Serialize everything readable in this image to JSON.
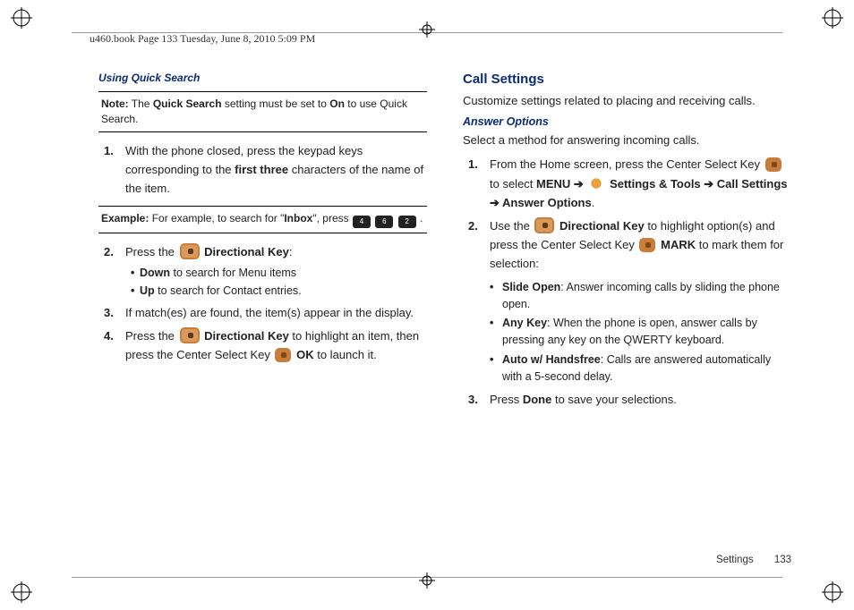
{
  "header": "u460.book  Page 133  Tuesday, June 8, 2010  5:09 PM",
  "left": {
    "heading": "Using Quick Search",
    "note_label": "Note:",
    "note_text_1": " The ",
    "note_bold_1": "Quick Search",
    "note_text_2": " setting must be set to ",
    "note_bold_2": "On",
    "note_text_3": " to use Quick Search.",
    "step1_a": "With the phone closed, press the keypad keys corresponding to the ",
    "step1_b": "first three",
    "step1_c": " characters of the name of the item.",
    "example_label": "Example:",
    "example_text_1": " For example, to search for \"",
    "example_bold": "Inbox",
    "example_text_2": "\", press ",
    "key4": "4",
    "key6": "6",
    "key2": "2",
    "example_period": " .",
    "step2_a": "Press the ",
    "step2_b": "Directional Key",
    "step2_c": ":",
    "sub_down_b": "Down",
    "sub_down_t": " to search for Menu items",
    "sub_up_b": "Up",
    "sub_up_t": " to search for Contact entries.",
    "step3": "If match(es) are found, the item(s) appear in the display.",
    "step4_a": "Press the ",
    "step4_b": "Directional Key",
    "step4_c": " to highlight an item, then press the Center Select Key ",
    "step4_d": "OK",
    "step4_e": " to launch it."
  },
  "right": {
    "heading": "Call Settings",
    "intro": "Customize settings related to placing and receiving calls.",
    "sub_heading": "Answer Options",
    "sub_intro": "Select a method for answering incoming calls.",
    "r1_a": "From the Home screen, press the Center Select Key ",
    "r1_b": " to select ",
    "r1_menu": "MENU",
    "r1_arrow": " ➔ ",
    "r1_st": "Settings & Tools",
    "r1_arrow2": "  ➔ ",
    "r1_cs": "Call Settings",
    "r1_arrow3": "  ➔ ",
    "r1_ao": "Answer Options",
    "r1_period": ".",
    "r2_a": "Use the ",
    "r2_b": "Directional Key",
    "r2_c": " to highlight option(s) and press the Center Select Key ",
    "r2_d": "MARK",
    "r2_e": " to mark them for selection:",
    "opt1_b": "Slide Open",
    "opt1_t": ": Answer incoming calls by sliding the phone open.",
    "opt2_b": "Any Key",
    "opt2_t": ": When the phone is open, answer calls by pressing any key on the QWERTY keyboard.",
    "opt3_b": "Auto w/ Handsfree",
    "opt3_t": ": Calls are answered automatically with a 5-second delay.",
    "r3_a": "Press ",
    "r3_b": "Done",
    "r3_c": " to save your selections."
  },
  "footer": {
    "section": "Settings",
    "page": "133"
  }
}
